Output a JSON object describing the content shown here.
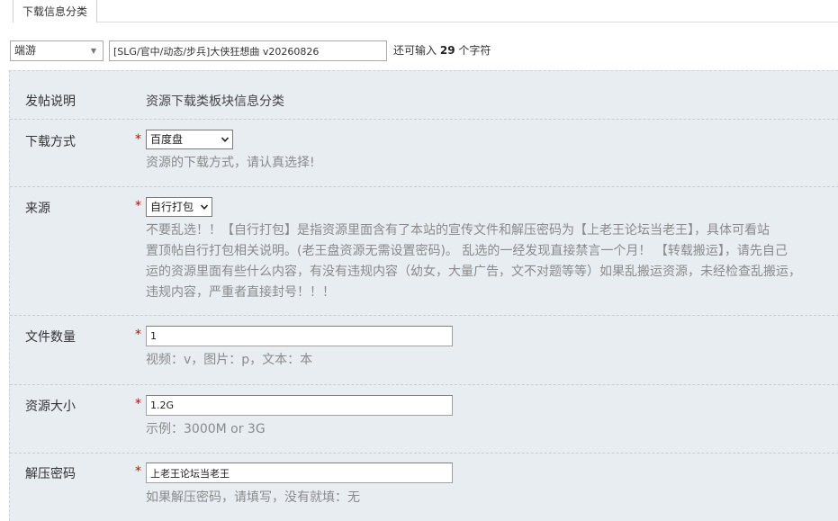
{
  "tabs": [
    {
      "label": "下载信息分类"
    }
  ],
  "subject": {
    "type_value": "端游",
    "title_value": "[SLG/官中/动态/步兵]大侠狂想曲 v20260826",
    "counter_prefix": "还可输入",
    "counter_value": "29",
    "counter_suffix": "个字符"
  },
  "fields": {
    "note": {
      "label": "发帖说明",
      "value": "资源下载类板块信息分类"
    },
    "download": {
      "label": "下载方式",
      "required": "*",
      "selected": "百度盘",
      "hint": "资源的下载方式，请认真选择!"
    },
    "source": {
      "label": "来源",
      "required": "*",
      "selected": "自行打包",
      "hint_lines": [
        "不要乱选！！【自行打包】是指资源里面含有了本站的宣传文件和解压密码为【上老王论坛当老王】，具体可看站",
        "置顶帖自行打包相关说明。(老王盘资源无需设置密码)。 乱选的一经发现直接禁言一个月！ 【转载搬运】，请先自己",
        "运的资源里面有些什么内容，有没有违规内容（幼女，大量广告，文不对题等等）如果乱搬运资源，未经检查乱搬运，",
        "违规内容，严重者直接封号！！！"
      ]
    },
    "file_count": {
      "label": "文件数量",
      "required": "*",
      "value": "1",
      "hint": "视频：v，图片：p，文本：本"
    },
    "size": {
      "label": "资源大小",
      "required": "*",
      "value": "1.2G",
      "hint": "示例：3000M or 3G"
    },
    "password": {
      "label": "解压密码",
      "required": "*",
      "value": "上老王论坛当老王",
      "hint": "如果解压密码，请填写，没有就填：无"
    }
  },
  "colors": {
    "panel_bg": "#e8edf2",
    "required": "#d40000",
    "hint": "#8a8a8a"
  }
}
